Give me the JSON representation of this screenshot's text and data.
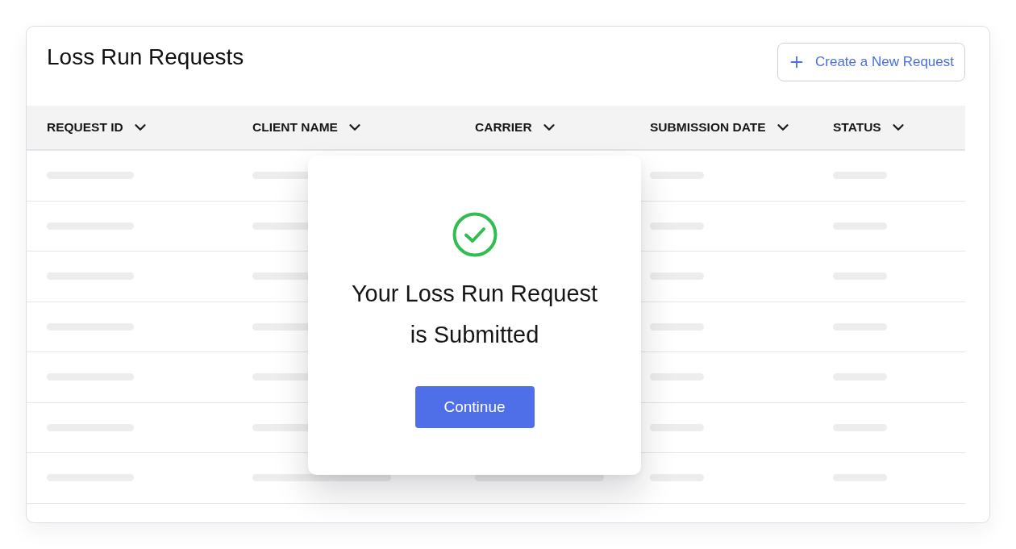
{
  "page": {
    "title": "Loss Run Requests",
    "create_button": {
      "label": "Create a New Request"
    }
  },
  "table": {
    "columns": [
      {
        "label": "REQUEST ID"
      },
      {
        "label": "CLIENT NAME"
      },
      {
        "label": "CARRIER"
      },
      {
        "label": "SUBMISSION DATE"
      },
      {
        "label": "STATUS"
      }
    ],
    "rows": [
      {
        "loading": true
      },
      {
        "loading": true
      },
      {
        "loading": true
      },
      {
        "loading": true
      },
      {
        "loading": true
      },
      {
        "loading": true
      },
      {
        "loading": true
      }
    ]
  },
  "dialog": {
    "message": "Your Loss Run Request is Submitted",
    "button": "Continue"
  }
}
